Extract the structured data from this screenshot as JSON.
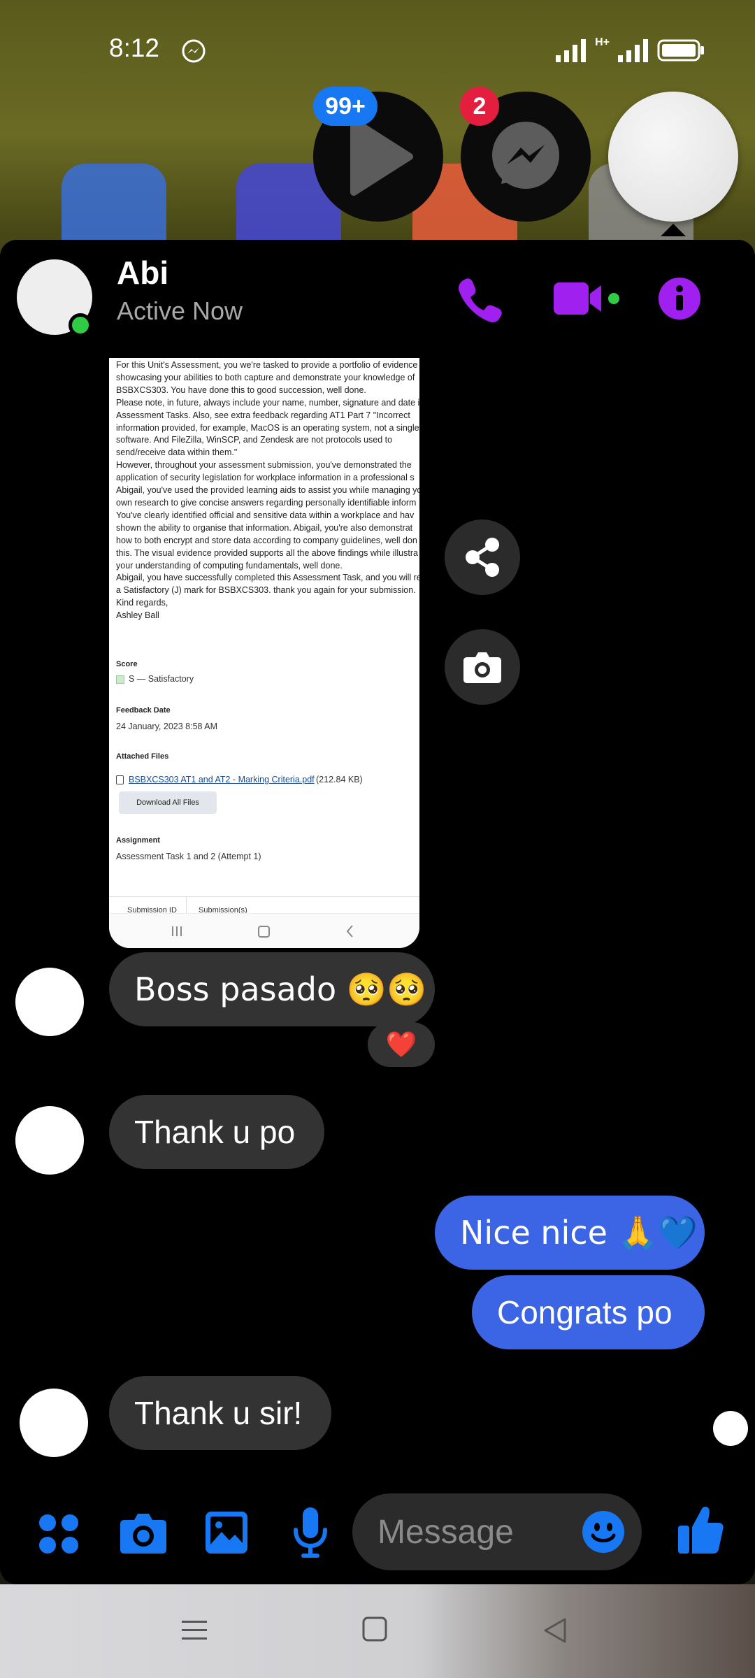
{
  "status_bar": {
    "time": "8:12",
    "app_icon": "messenger-icon",
    "network": "H+"
  },
  "chat_heads": [
    {
      "name": "play-icon",
      "badge": "99+"
    },
    {
      "name": "messenger-icon",
      "badge": "2"
    },
    {
      "name": "avatar",
      "badge": ""
    }
  ],
  "header": {
    "contact_name": "Abi",
    "status": "Active Now",
    "accent_color": "#a020f0"
  },
  "shared_image": {
    "body_text": "For this Unit's Assessment, you we're tasked to provide a portfolio of evidence\nshowcasing your abilities to both capture and demonstrate your knowledge of\nBSBXCS303. You have done this to good succession, well done.\nPlease note, in future, always include your name, number, signature and date i\nAssessment Tasks. Also, see extra feedback regarding AT1 Part 7 \"Incorrect\ninformation provided, for example, MacOS is an operating system, not a single\nsoftware. And FileZilla, WinSCP, and Zendesk are not protocols used to\nsend/receive data within them.\"\nHowever, throughout your assessment submission, you've demonstrated the\napplication of security legislation for workplace information in a professional s\nAbigail, you've used the provided learning aids to assist you while managing yo\nown research to give concise answers regarding personally identifiable inform\nYou've clearly identified official and sensitive data within a workplace and hav\nshown the ability to organise that information. Abigail, you're also demonstrat\nhow to both encrypt and store data according to company guidelines, well don\nthis. The visual evidence provided supports all the above findings while illustra\nyour understanding of computing fundamentals, well done.\nAbigail, you have successfully completed this Assessment Task, and you will re\na Satisfactory (J) mark for BSBXCS303. thank you again for your submission.\nKind regards,\nAshley Ball",
    "score_label": "Score",
    "score_value": "S — Satisfactory",
    "feedback_date_label": "Feedback Date",
    "feedback_date": "24 January, 2023 8:58 AM",
    "attached_files_label": "Attached Files",
    "file_name": "BSBXCS303 AT1 and AT2 - Marking Criteria.pdf",
    "file_size": "(212.84 KB)",
    "download_button": "Download All Files",
    "assignment_label": "Assignment",
    "assignment_value": "Assessment Task 1 and 2 (Attempt 1)",
    "table_col1": "Submission ID",
    "table_col2": "Submission(s)"
  },
  "messages": [
    {
      "direction": "in",
      "text": "Boss pasado 🥺🥺",
      "reaction": "❤️"
    },
    {
      "direction": "in",
      "text": "Thank u po"
    },
    {
      "direction": "out",
      "text": "Nice nice 🙏💙"
    },
    {
      "direction": "out",
      "text": "Congrats po"
    },
    {
      "direction": "in",
      "text": "Thank u sir!"
    }
  ],
  "composer": {
    "placeholder": "Message",
    "icons": [
      "apps-icon",
      "camera-icon",
      "gallery-icon",
      "microphone-icon",
      "emoji-icon",
      "like-icon"
    ],
    "accent_color": "#1877f2"
  },
  "colors": {
    "incoming_bubble": "#333333",
    "outgoing_bubble": "#3b65e4",
    "online": "#31cc46"
  }
}
